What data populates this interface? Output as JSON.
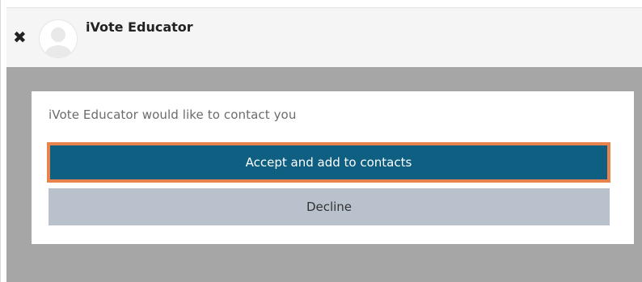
{
  "header": {
    "close_icon": "close-icon",
    "contact_name": "iVote Educator",
    "avatar_icon": "default-avatar-icon"
  },
  "dialog": {
    "prompt": "iVote Educator would like to contact you",
    "accept_label": "Accept and add to contacts",
    "decline_label": "Decline"
  },
  "colors": {
    "accept_bg": "#0e5f82",
    "accept_focus_border": "#e8834e",
    "decline_bg": "#b9c2cc",
    "overlay_bg": "#a6a6a6",
    "header_bg": "#f5f5f5"
  }
}
